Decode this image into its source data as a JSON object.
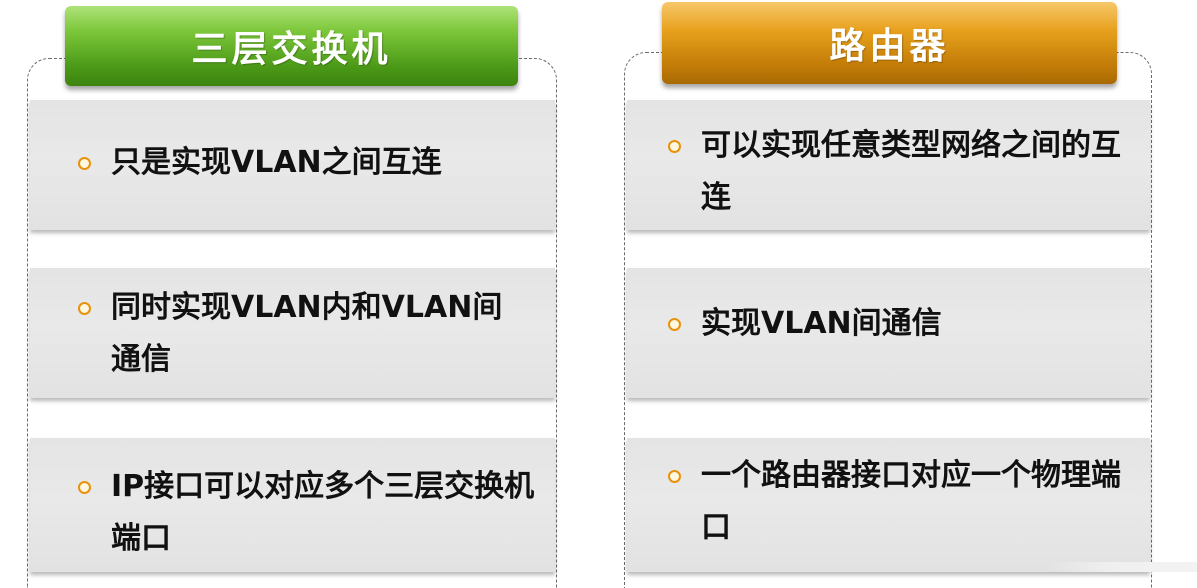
{
  "columns": {
    "left": {
      "title": "三层交换机",
      "items": [
        "只是实现VLAN之间互连",
        "同时实现VLAN内和VLAN间通信",
        "IP接口可以对应多个三层交换机端口"
      ]
    },
    "right": {
      "title": "路由器",
      "items": [
        "可以实现任意类型网络之间的互连",
        "实现VLAN间通信",
        "一个路由器接口对应一个物理端口"
      ]
    }
  },
  "colors": {
    "left_header": "#5fae24",
    "right_header": "#d58a0c",
    "bullet": "#e8920c",
    "band": "#e6e6e6"
  },
  "icons": {
    "bullet": "bullet-circle-icon"
  }
}
